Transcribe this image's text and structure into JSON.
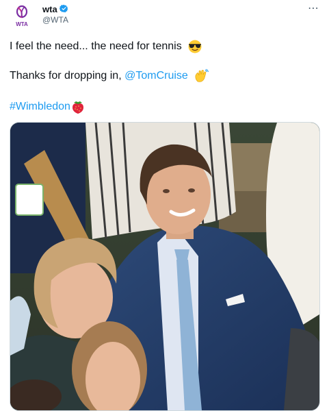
{
  "author": {
    "display_name": "wta",
    "handle": "@WTA",
    "logo_text": "WTA"
  },
  "tweet": {
    "line1": "I feel the need... the need for tennis",
    "line2_prefix": "Thanks for dropping in, ",
    "mention": "@TomCruise",
    "hashtag": "#Wimbledon"
  },
  "icons": {
    "verified": "verified-badge-icon",
    "more": "more-icon",
    "sunglasses": "sunglasses-emoji-icon",
    "wave": "waving-hand-emoji-icon",
    "strawberry": "strawberry-emoji-icon"
  },
  "colors": {
    "link": "#1d9bf0",
    "text": "#0f1419",
    "secondary": "#536471",
    "brand": "#7b2ea3"
  }
}
